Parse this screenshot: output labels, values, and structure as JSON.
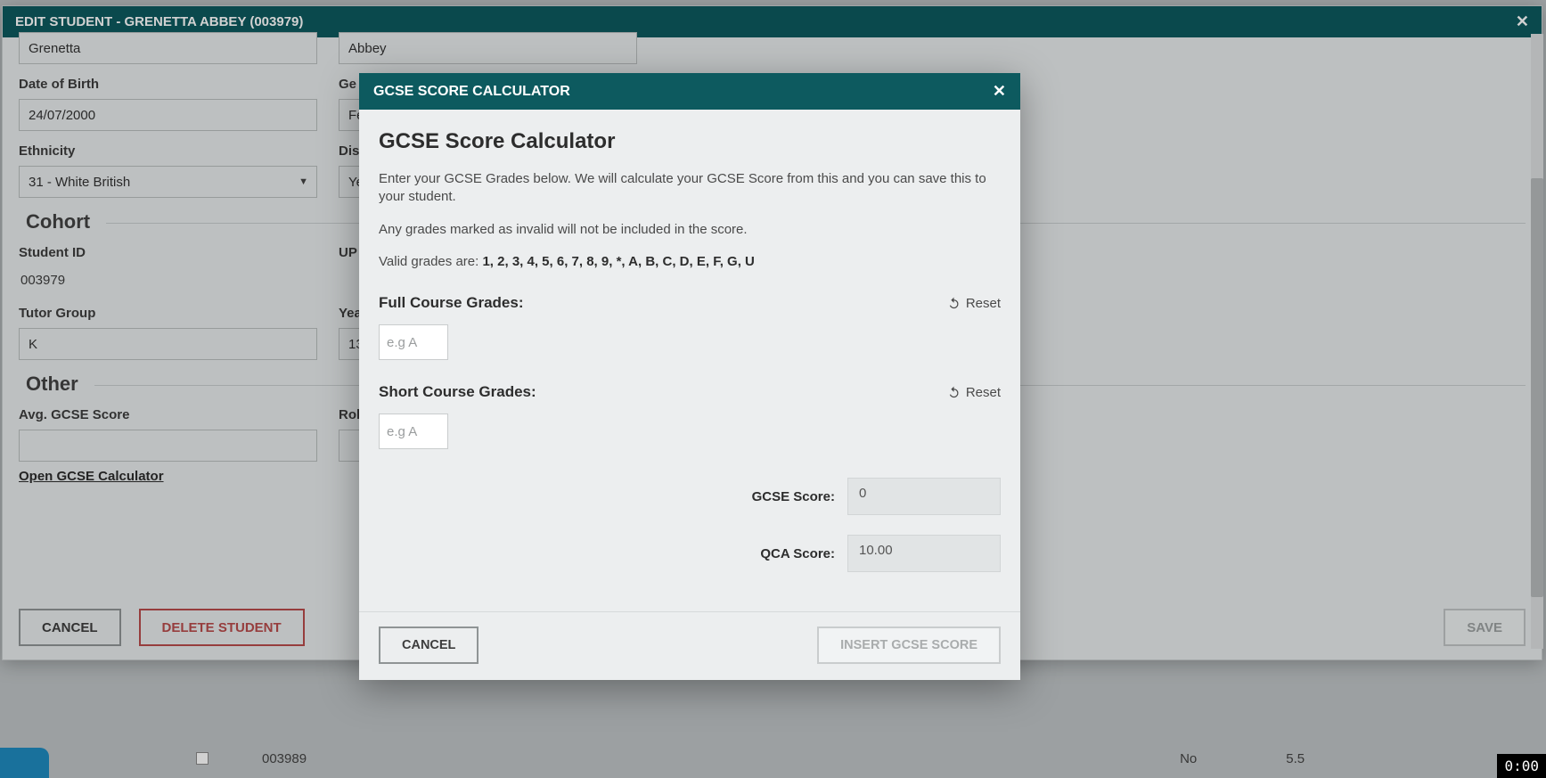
{
  "edit_dialog": {
    "title": "EDIT STUDENT - GRENETTA ABBEY (003979)",
    "first_name": "Grenetta",
    "last_name": "Abbey",
    "dob_label": "Date of Birth",
    "dob": "24/07/2000",
    "gender_label": "Ge",
    "gender_value_partial": "Fe",
    "ethnicity_label": "Ethnicity",
    "ethnicity": "31 - White British",
    "disability_label": "Dis",
    "disability_value_partial": "Ye",
    "cohort_legend": "Cohort",
    "student_id_label": "Student ID",
    "student_id": "003979",
    "upn_label": "UP",
    "tutor_group_label": "Tutor Group",
    "tutor_group": "K",
    "year_label": "Yea",
    "year_value_partial": "13",
    "other_legend": "Other",
    "avg_gcse_label": "Avg. GCSE Score",
    "role_label": "Rol",
    "open_calc_link": "Open GCSE Calculator",
    "cancel_label": "CANCEL",
    "delete_label": "DELETE STUDENT",
    "save_label": "SAVE"
  },
  "calc_modal": {
    "titlebar": "GCSE SCORE CALCULATOR",
    "heading": "GCSE Score Calculator",
    "intro1": "Enter your GCSE Grades below. We will calculate your GCSE Score from this and you can save this to your student.",
    "intro2": "Any grades marked as invalid will not be included in the score.",
    "valid_prefix": "Valid grades are: ",
    "valid_list": "1, 2, 3, 4, 5, 6, 7, 8, 9, *, A, B, C, D, E, F, G, U",
    "full_label": "Full Course Grades:",
    "short_label": "Short Course Grades:",
    "reset_label": "Reset",
    "grade_placeholder": "e.g A",
    "gcse_score_label": "GCSE Score:",
    "gcse_score_value": "0",
    "qca_score_label": "QCA Score:",
    "qca_score_value": "10.00",
    "cancel_label": "CANCEL",
    "insert_label": "INSERT GCSE SCORE"
  },
  "under_row": {
    "id": "003989",
    "no": "No",
    "score": "5.5"
  },
  "video_time": "0:00"
}
